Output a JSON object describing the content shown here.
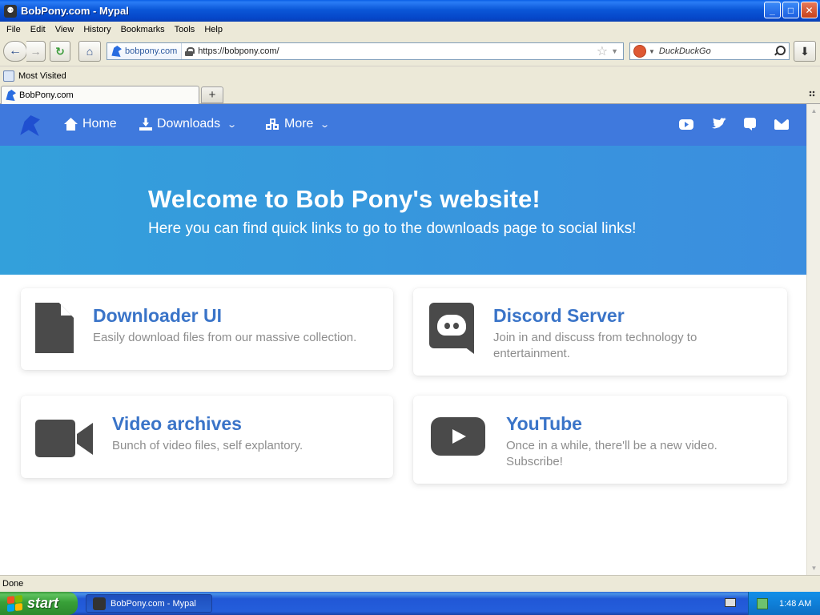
{
  "window": {
    "title": "BobPony.com - Mypal",
    "controls": {
      "minimize": "_",
      "maximize": "□",
      "close": "✕"
    }
  },
  "menubar": {
    "items": [
      "File",
      "Edit",
      "View",
      "History",
      "Bookmarks",
      "Tools",
      "Help"
    ]
  },
  "toolbar": {
    "identity_label": "bobpony.com",
    "url": "https://bobpony.com/",
    "search_engine": "DuckDuckGo",
    "search_placeholder": "DuckDuckGo"
  },
  "bookmarks": {
    "items": [
      "Most Visited"
    ]
  },
  "tabs": [
    {
      "label": "BobPony.com"
    }
  ],
  "site": {
    "nav": {
      "home": "Home",
      "downloads": "Downloads",
      "more": "More",
      "social_icons": [
        "youtube-icon",
        "twitter-icon",
        "discord-icon",
        "mail-icon"
      ]
    },
    "hero": {
      "title": "Welcome to Bob Pony's website!",
      "subtitle": "Here you can find quick links to go to the downloads page to social links!"
    },
    "cards": [
      {
        "title": "Downloader UI",
        "description": "Easily download files from our massive collection.",
        "icon": "file-icon"
      },
      {
        "title": "Discord Server",
        "description": "Join in and discuss from technology to entertainment.",
        "icon": "discord-icon"
      },
      {
        "title": "Video archives",
        "description": "Bunch of video files, self explantory.",
        "icon": "video-camera-icon"
      },
      {
        "title": "YouTube",
        "description": "Once in a while, there'll be a new video. Subscribe!",
        "icon": "youtube-icon"
      }
    ],
    "colors": {
      "nav_bg": "#3f79dd",
      "hero_bg": "#38a0dc",
      "card_title": "#3a74c8",
      "card_desc": "#8d8d8d",
      "icon_fill": "#4a4a4a"
    }
  },
  "statusbar": {
    "text": "Done"
  },
  "taskbar": {
    "start_label": "start",
    "task_label": "BobPony.com - Mypal",
    "clock": "1:48 AM"
  }
}
